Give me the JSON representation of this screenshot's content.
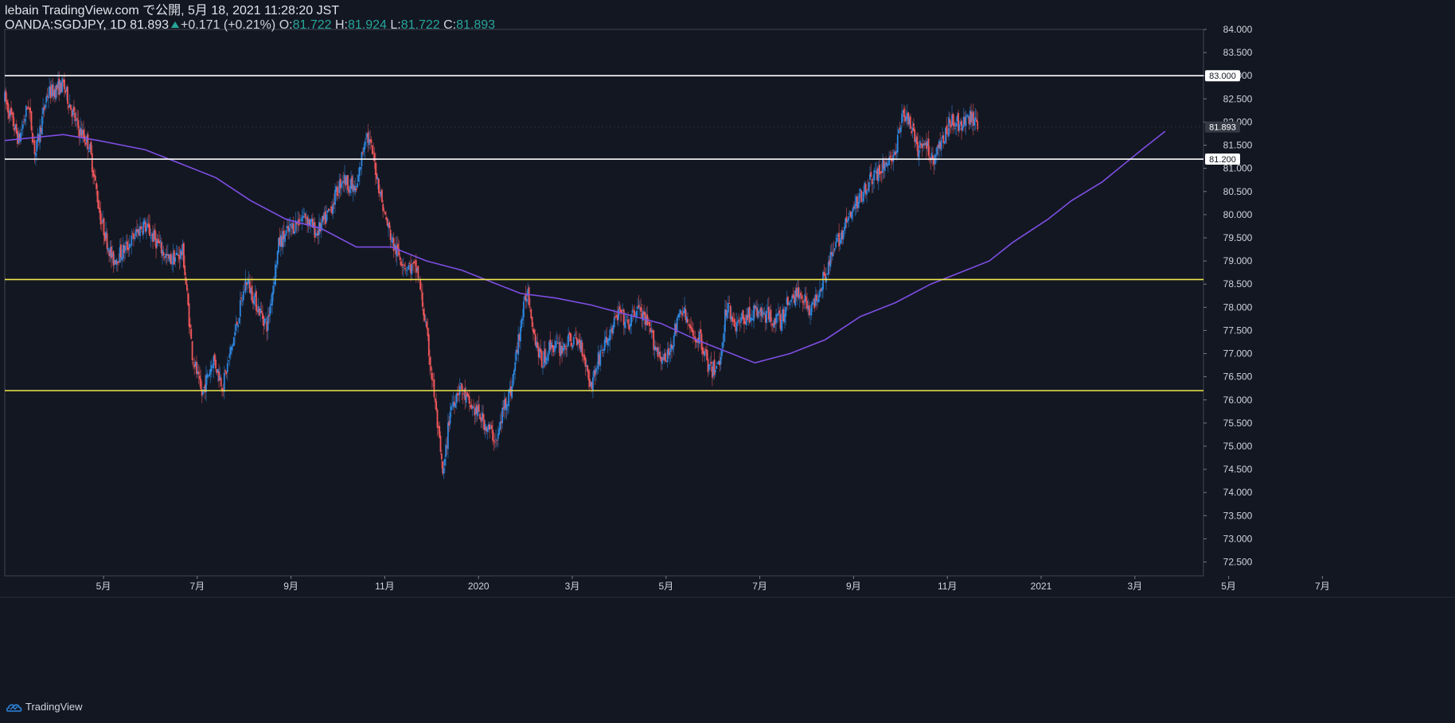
{
  "header": {
    "line1": "lebain TradingView.com で公開, 5月 18, 2021 11:28:20 JST",
    "symbol": "OANDA:SGDJPY, 1D 81.893",
    "change": "+0.171 (+0.21%)",
    "o_label": "O:",
    "o_value": "81.722",
    "h_label": "H:",
    "h_value": "81.924",
    "l_label": "L:",
    "l_value": "81.722",
    "c_label": "C:",
    "c_value": "81.893"
  },
  "brand": {
    "name": "TradingView",
    "icon": "tradingview-cloud-logo-icon"
  },
  "colors": {
    "background": "#131722",
    "up": "#2e86de",
    "down": "#f0575a",
    "ma": "#7e4ee3",
    "support": "#f2e94e",
    "resistance": "#ffffff",
    "price_line": "#2a2e39"
  },
  "chart_data": {
    "type": "candlestick",
    "symbol": "OANDA:SGDJPY",
    "interval": "1D",
    "ylim": [
      72.2,
      84.0
    ],
    "y_ticks": [
      "72.500",
      "73.000",
      "73.500",
      "74.000",
      "74.500",
      "75.000",
      "75.500",
      "76.000",
      "76.500",
      "77.000",
      "77.500",
      "78.000",
      "78.500",
      "79.000",
      "79.500",
      "80.000",
      "80.500",
      "81.000",
      "81.500",
      "82.000",
      "82.500",
      "83.000",
      "83.500",
      "84.000"
    ],
    "x_ticks": [
      "5月",
      "7月",
      "9月",
      "11月",
      "2020",
      "3月",
      "5月",
      "7月",
      "9月",
      "11月",
      "2021",
      "3月",
      "5月",
      "7月"
    ],
    "x_tick_months": [
      2,
      4,
      6,
      8,
      10,
      12,
      14,
      16,
      18,
      20,
      22,
      24,
      26,
      28
    ],
    "price_path": [
      [
        0,
        82.5
      ],
      [
        0.6,
        81.6
      ],
      [
        1.0,
        82.4
      ],
      [
        1.3,
        81.3
      ],
      [
        1.8,
        82.6
      ],
      [
        2.5,
        82.8
      ],
      [
        3.1,
        81.9
      ],
      [
        3.6,
        81.5
      ],
      [
        4.1,
        79.9
      ],
      [
        4.6,
        79.0
      ],
      [
        5.2,
        79.3
      ],
      [
        5.9,
        79.8
      ],
      [
        6.5,
        79.4
      ],
      [
        7.0,
        79.0
      ],
      [
        7.6,
        79.2
      ],
      [
        8.0,
        77.0
      ],
      [
        8.4,
        76.1
      ],
      [
        8.9,
        76.9
      ],
      [
        9.3,
        76.3
      ],
      [
        9.8,
        77.4
      ],
      [
        10.3,
        78.6
      ],
      [
        10.8,
        78.0
      ],
      [
        11.2,
        77.6
      ],
      [
        11.7,
        79.4
      ],
      [
        12.2,
        79.7
      ],
      [
        12.8,
        80.0
      ],
      [
        13.3,
        79.6
      ],
      [
        13.8,
        80.0
      ],
      [
        14.4,
        80.8
      ],
      [
        15.0,
        80.5
      ],
      [
        15.4,
        81.8
      ],
      [
        15.7,
        81.3
      ],
      [
        16.2,
        80.0
      ],
      [
        16.6,
        79.3
      ],
      [
        17.1,
        78.9
      ],
      [
        17.6,
        78.8
      ],
      [
        17.9,
        77.8
      ],
      [
        18.3,
        76.2
      ],
      [
        18.7,
        74.3
      ],
      [
        19.0,
        75.8
      ],
      [
        19.4,
        76.3
      ],
      [
        19.8,
        75.9
      ],
      [
        20.2,
        75.7
      ],
      [
        20.6,
        75.4
      ],
      [
        21.0,
        75.1
      ],
      [
        21.3,
        75.9
      ],
      [
        21.6,
        76.2
      ],
      [
        22.0,
        77.6
      ],
      [
        22.3,
        78.4
      ],
      [
        22.6,
        77.4
      ],
      [
        22.9,
        76.8
      ],
      [
        23.3,
        77.2
      ],
      [
        23.7,
        77.1
      ],
      [
        24.2,
        77.3
      ],
      [
        24.6,
        77.2
      ],
      [
        25.0,
        76.3
      ],
      [
        25.4,
        77.0
      ],
      [
        25.8,
        77.4
      ],
      [
        26.2,
        77.9
      ],
      [
        26.6,
        77.6
      ],
      [
        27.0,
        78.0
      ],
      [
        27.5,
        77.5
      ],
      [
        27.8,
        77.1
      ],
      [
        28.2,
        76.8
      ],
      [
        28.6,
        77.5
      ],
      [
        28.9,
        78.0
      ],
      [
        29.3,
        77.4
      ],
      [
        29.7,
        77.3
      ],
      [
        30.1,
        76.6
      ],
      [
        30.5,
        76.8
      ],
      [
        30.8,
        78.1
      ],
      [
        31.2,
        77.6
      ],
      [
        31.6,
        77.8
      ],
      [
        32.1,
        77.9
      ],
      [
        32.6,
        77.8
      ],
      [
        33.1,
        77.7
      ],
      [
        33.5,
        78.2
      ],
      [
        34.0,
        78.3
      ],
      [
        34.4,
        77.9
      ],
      [
        34.8,
        78.5
      ],
      [
        35.2,
        79.0
      ],
      [
        35.6,
        79.5
      ],
      [
        36.0,
        79.9
      ],
      [
        36.4,
        80.3
      ],
      [
        36.8,
        80.7
      ],
      [
        37.3,
        80.9
      ],
      [
        37.7,
        81.2
      ],
      [
        38.0,
        81.3
      ],
      [
        38.3,
        82.2
      ],
      [
        38.6,
        82.0
      ],
      [
        38.9,
        81.4
      ],
      [
        39.3,
        81.5
      ],
      [
        39.6,
        81.2
      ],
      [
        40.0,
        81.6
      ],
      [
        40.4,
        82.1
      ],
      [
        40.8,
        81.9
      ],
      [
        41.2,
        82.1
      ],
      [
        41.5,
        81.893
      ]
    ],
    "moving_average": [
      [
        0,
        81.6
      ],
      [
        2.5,
        81.73
      ],
      [
        4,
        81.6
      ],
      [
        6,
        81.4
      ],
      [
        7.5,
        81.1
      ],
      [
        9,
        80.8
      ],
      [
        10.5,
        80.3
      ],
      [
        12,
        79.9
      ],
      [
        13.5,
        79.7
      ],
      [
        15,
        79.3
      ],
      [
        16.5,
        79.3
      ],
      [
        18,
        79.0
      ],
      [
        19.5,
        78.8
      ],
      [
        21,
        78.5
      ],
      [
        22,
        78.3
      ],
      [
        23.5,
        78.2
      ],
      [
        25,
        78.05
      ],
      [
        26.5,
        77.85
      ],
      [
        28,
        77.65
      ],
      [
        29.5,
        77.3
      ],
      [
        31,
        77.0
      ],
      [
        32,
        76.8
      ],
      [
        33.5,
        77.0
      ],
      [
        35,
        77.3
      ],
      [
        36.5,
        77.8
      ],
      [
        38,
        78.1
      ],
      [
        39.5,
        78.5
      ],
      [
        41,
        78.8
      ],
      [
        42,
        79.0
      ],
      [
        43,
        79.4
      ],
      [
        44.5,
        79.9
      ],
      [
        45.5,
        80.3
      ],
      [
        46.8,
        80.7
      ],
      [
        48.5,
        81.4
      ],
      [
        49.5,
        81.8
      ]
    ],
    "horizontal_lines": [
      {
        "price": 83.0,
        "label": "83.000",
        "style": "resistance"
      },
      {
        "price": 81.2,
        "label": "81.200",
        "style": "resistance"
      },
      {
        "price": 78.6,
        "label": "",
        "style": "support"
      },
      {
        "price": 76.2,
        "label": "",
        "style": "support"
      }
    ],
    "last_price": {
      "price": 81.893,
      "label": "81.893"
    }
  }
}
